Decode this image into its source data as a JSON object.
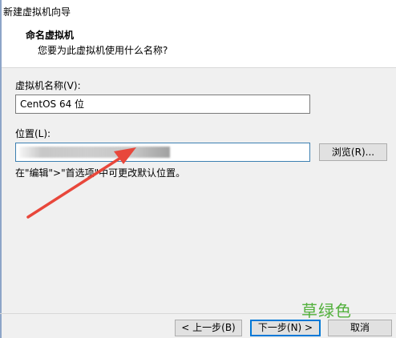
{
  "window": {
    "title": "新建虚拟机向导"
  },
  "header": {
    "title": "命名虚拟机",
    "subtitle": "您要为此虚拟机使用什么名称?"
  },
  "form": {
    "vm_name_label": "虚拟机名称(V):",
    "vm_name_value": "CentOS 64 位",
    "location_label": "位置(L):",
    "location_value": "",
    "browse_label": "浏览(R)...",
    "hint": "在\"编辑\">\"首选项\"中可更改默认位置。"
  },
  "footer": {
    "back_label": "< 上一步(B)",
    "next_label": "下一步(N) >",
    "cancel_label": "取消"
  },
  "watermark": {
    "text": "草绿色"
  },
  "colors": {
    "arrow": "#e8473b",
    "watermark": "#52b03c",
    "accent": "#0078d7"
  }
}
